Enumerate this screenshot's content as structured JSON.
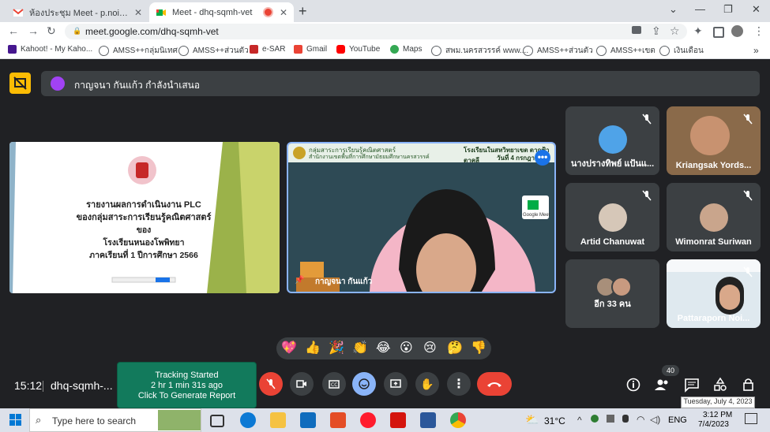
{
  "browser": {
    "tabs": [
      {
        "title": "ห้องประชุม Meet - p.noigor@gmai"
      },
      {
        "title": "Meet - dhq-sqmh-vet"
      }
    ],
    "url": "meet.google.com/dhq-sqmh-vet",
    "bookmarks": [
      {
        "label": "Kahoot! - My Kaho..."
      },
      {
        "label": "AMSS++กลุ่มนิเทศ"
      },
      {
        "label": "AMSS++ส่วนตัว"
      },
      {
        "label": "e-SAR"
      },
      {
        "label": "Gmail"
      },
      {
        "label": "YouTube"
      },
      {
        "label": "Maps"
      },
      {
        "label": "สพม.นครสวรรค์ www...."
      },
      {
        "label": "AMSS++ส่วนตัว"
      },
      {
        "label": "AMSS++เขต"
      },
      {
        "label": "เงินเดือน"
      }
    ]
  },
  "meet": {
    "presenting_text": "กาญจนา กันแก้ว กำลังนำเสนอ",
    "slide": {
      "lines": [
        "รายงานผลการดำเนินงาน PLC",
        "ของกลุ่มสาระการเรียนรู้คณิตศาสตร์",
        "ของ",
        "โรงเรียนหนองโพพิทยา",
        "ภาคเรียนที่ 1 ปีการศึกษา 2566"
      ]
    },
    "video": {
      "name": "กาญจนา กันแก้ว",
      "header_line1": "กลุ่มสาระการเรียนรู้คณิตศาสตร์",
      "header_line2": "สำนักงานเขตพื้นที่การศึกษามัธยมศึกษานครสวรรค์",
      "header_school": "โรงเรียนในสหวิทยาเขต ตากฟ้า ตาคลี",
      "header_date": "วันที่ 4 กรกฎาค",
      "meet_badge": "Google Meet"
    },
    "participants": [
      {
        "name": "นางปรางทิพย์ แป้นแ..."
      },
      {
        "name": "Kriangsak Yords..."
      },
      {
        "name": "Artid Chanuwat"
      },
      {
        "name": "Wimonrat Suriwan"
      },
      {
        "name": "อีก 33 คน"
      },
      {
        "name": "Pattaraporn Noi..."
      }
    ],
    "reactions": [
      "💖",
      "👍",
      "🎉",
      "👏",
      "😂",
      "😮",
      "😢",
      "🤔",
      "👎"
    ],
    "time": "15:12",
    "meeting_code": "dhq-sqmh-...",
    "tracking": {
      "line1": "Tracking Started",
      "line2": "2 hr 1 min 31s ago",
      "line3": "Click To Generate Report"
    },
    "people_count": "40",
    "tooltip": "Tuesday, July 4, 2023"
  },
  "taskbar": {
    "search_placeholder": "Type here to search",
    "weather": "31°C",
    "language": "ENG",
    "time": "3:12 PM",
    "date": "7/4/2023"
  },
  "colors": {
    "accent": "#8ab4f8",
    "leave": "#ea4335",
    "present": "#fbbc04",
    "tracking": "#127a5c"
  }
}
